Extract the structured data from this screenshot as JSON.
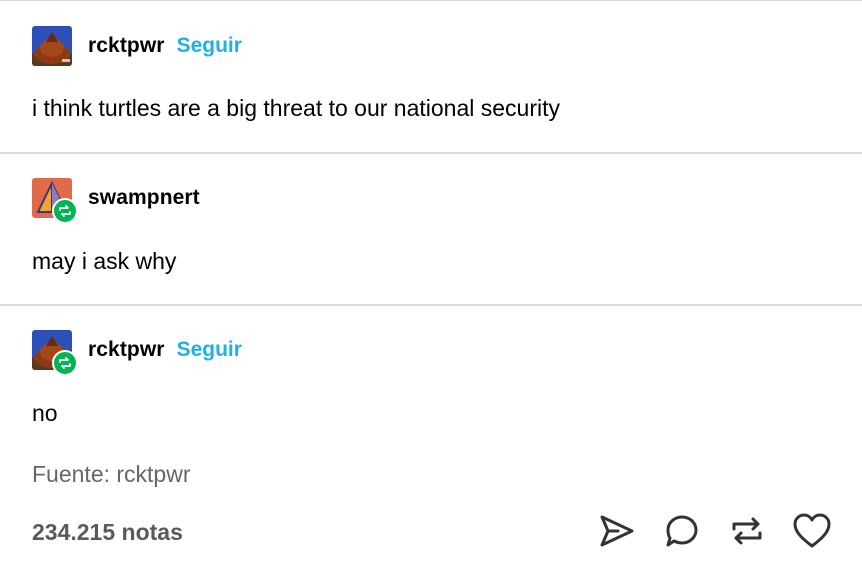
{
  "posts": [
    {
      "username": "rcktpwr",
      "follow_label": "Seguir",
      "text": "i think turtles are a big threat to our national security",
      "reblog_badge": false,
      "avatar_icon": "turtle-avatar-icon"
    },
    {
      "username": "swampnert",
      "text": "may i ask why",
      "reblog_badge": true,
      "avatar_icon": "pyramid-avatar-icon"
    },
    {
      "username": "rcktpwr",
      "follow_label": "Seguir",
      "text": "no",
      "reblog_badge": true,
      "avatar_icon": "turtle-avatar-icon"
    }
  ],
  "source": "Fuente: rcktpwr",
  "notes": "234.215 notas",
  "actions": [
    "share-icon",
    "reply-icon",
    "reblog-icon",
    "like-icon"
  ],
  "colors": {
    "follow": "#1eb0e6",
    "reblog_badge": "#00b453",
    "divider": "#d9d9d9",
    "muted_text": "#666666"
  }
}
